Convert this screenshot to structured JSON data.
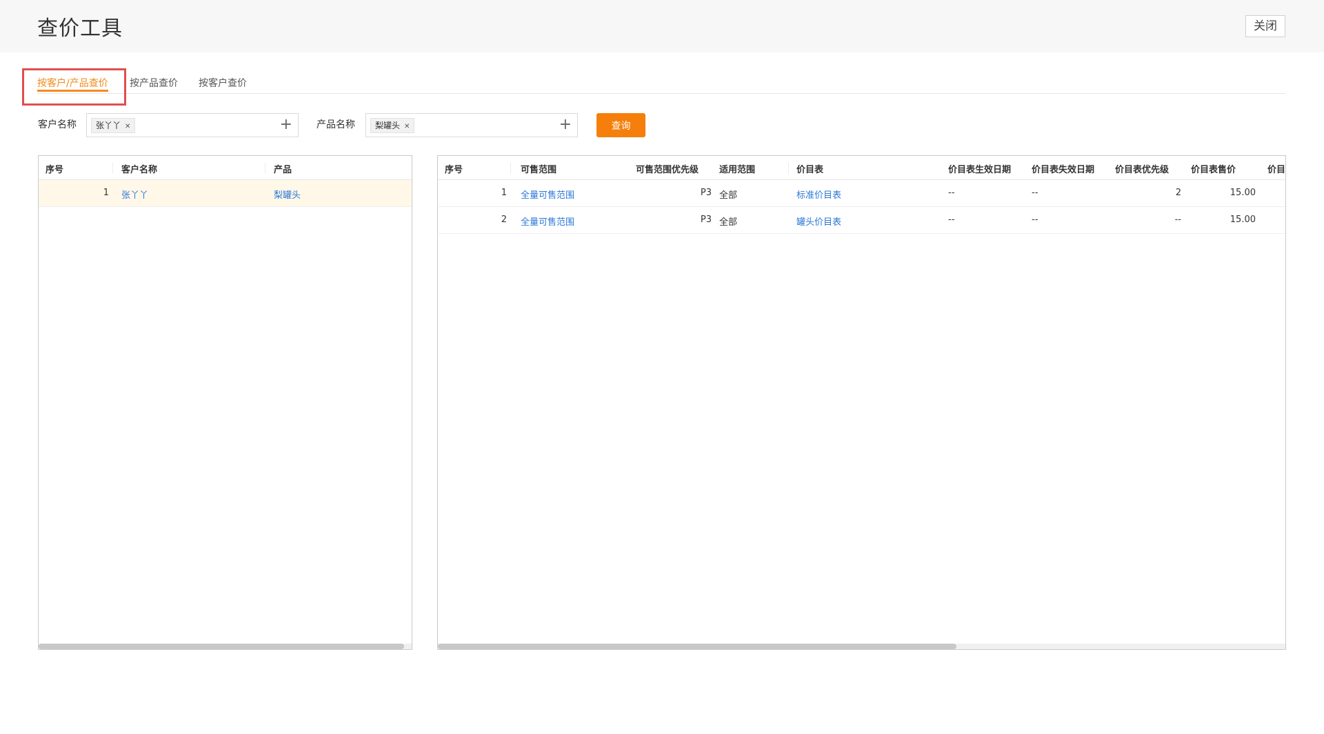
{
  "header": {
    "title": "查价工具",
    "close_label": "关闭"
  },
  "tabs": [
    {
      "label": "按客户/产品查价",
      "active": true
    },
    {
      "label": "按产品查价",
      "active": false
    },
    {
      "label": "按客户查价",
      "active": false
    }
  ],
  "filters": {
    "customer_label": "客户名称",
    "customer_tag": "张丫丫",
    "product_label": "产品名称",
    "product_tag": "梨罐头",
    "query_label": "查询"
  },
  "left_table": {
    "columns": [
      "序号",
      "客户名称",
      "产品"
    ],
    "rows": [
      {
        "index": "1",
        "customer": "张丫丫",
        "product": "梨罐头"
      }
    ]
  },
  "right_table": {
    "columns": [
      "序号",
      "可售范围",
      "可售范围优先级",
      "适用范围",
      "价目表",
      "价目表生效日期",
      "价目表失效日期",
      "价目表优先级",
      "价目表售价",
      "价目"
    ],
    "rows": [
      {
        "index": "1",
        "range": "全量可售范围",
        "range_priority": "P3",
        "scope": "全部",
        "price_list": "标准价目表",
        "effective": "--",
        "expire": "--",
        "list_priority": "2",
        "price": "15.00"
      },
      {
        "index": "2",
        "range": "全量可售范围",
        "range_priority": "P3",
        "scope": "全部",
        "price_list": "罐头价目表",
        "effective": "--",
        "expire": "--",
        "list_priority": "--",
        "price": "15.00"
      }
    ]
  },
  "colors": {
    "accent": "#f57f0a",
    "link": "#2d78d8",
    "highlight": "#e04e4e",
    "selected_row": "#fff8e8"
  },
  "icons": {
    "add": "plus-icon",
    "remove": "close-x-icon"
  }
}
